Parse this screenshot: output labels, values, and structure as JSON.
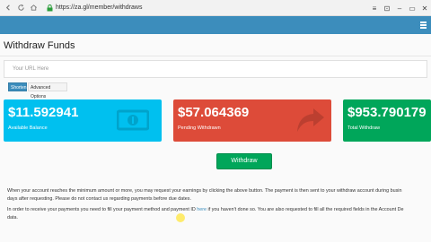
{
  "browser": {
    "url": "https://za.gl/member/withdraws",
    "buttons": [
      "≡",
      "⊡",
      "‒",
      "▭",
      "✕"
    ]
  },
  "page": {
    "title": "Withdraw Funds"
  },
  "shorten": {
    "placeholder": "Your URL Here",
    "tabs": [
      "Shorten",
      "Advanced Options"
    ]
  },
  "stats": [
    {
      "value": "$11.592941",
      "label": "Available Balance"
    },
    {
      "value": "$57.064369",
      "label": "Pending Withdrawn"
    },
    {
      "value": "$953.790179",
      "label": "Total Withdraw"
    }
  ],
  "withdraw_button": "Withdraw",
  "text": {
    "para1_line1": "When your account reaches the minimum amount or more, you may request your earnings by clicking the above button. The payment is then sent to your withdraw account during busin",
    "para1_line2": "days after requesting. Please do not contact us regarding payments before due dates.",
    "para2_line1_a": "In order to receive your payments you need to fill your payment method and payment ID ",
    "para2_link": "here",
    "para2_line1_b": " if you haven't done so. You are also requested to fill all the required fields in the Account De",
    "para2_line2": "data."
  },
  "colors": {
    "header": "#3c8dbc",
    "aqua": "#00c0ef",
    "red": "#dd4b39",
    "green": "#00a65a"
  }
}
